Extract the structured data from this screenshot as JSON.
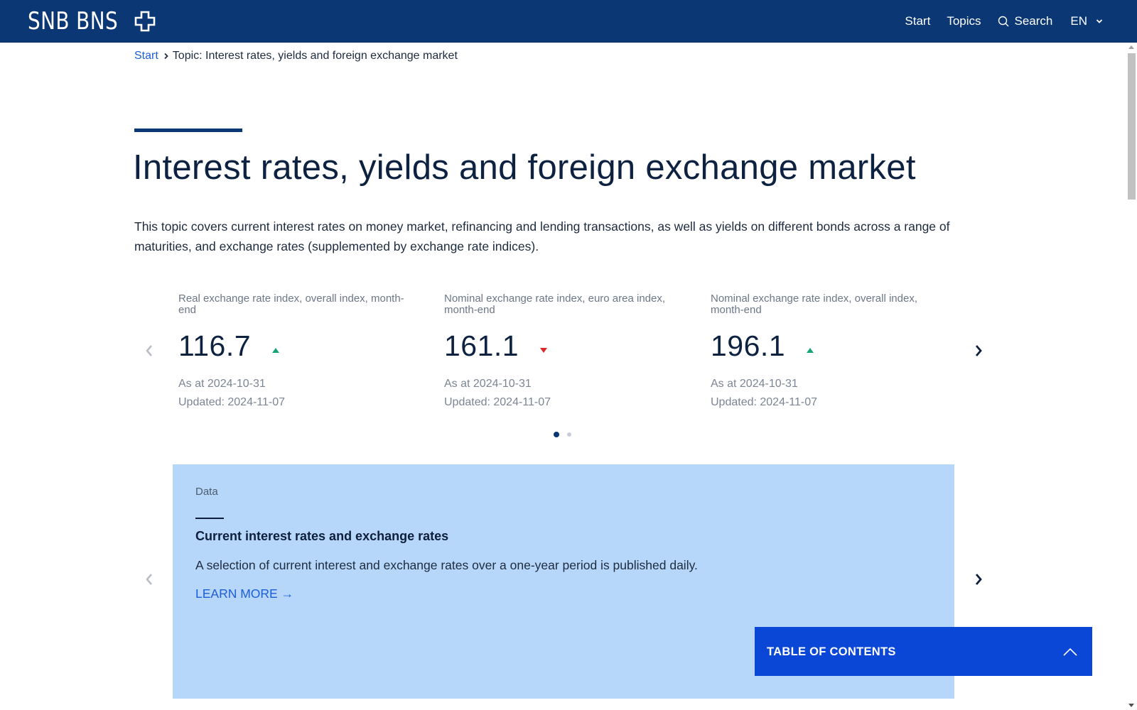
{
  "header": {
    "logo_text": "SNB BNS",
    "nav": {
      "start": "Start",
      "topics": "Topics",
      "search": "Search",
      "language": "EN"
    }
  },
  "breadcrumb": {
    "start": "Start",
    "current": "Topic: Interest rates, yields and foreign exchange market"
  },
  "page": {
    "title": "Interest rates, yields and foreign exchange market",
    "intro": "This topic covers current interest rates on money market, refinancing and lending transactions, as well as yields on different bonds across a range of maturities, and exchange rates (supplemented by exchange rate indices)."
  },
  "indicators": [
    {
      "label": "Real exchange rate index, overall index, month-end",
      "value": "116.7",
      "trend": "up",
      "as_at": "As at 2024-10-31",
      "updated": "Updated: 2024-11-07"
    },
    {
      "label": "Nominal exchange rate index, euro area index, month-end",
      "value": "161.1",
      "trend": "down",
      "as_at": "As at 2024-10-31",
      "updated": "Updated: 2024-11-07"
    },
    {
      "label": "Nominal exchange rate index, overall index, month-end",
      "value": "196.1",
      "trend": "up",
      "as_at": "As at 2024-10-31",
      "updated": "Updated: 2024-11-07"
    }
  ],
  "carousel": {
    "pages": 2,
    "active_page": 1
  },
  "card": {
    "kicker": "Data",
    "title": "Current interest rates and exchange rates",
    "text": "A selection of current interest and exchange rates over a one-year period is published daily.",
    "link": "LEARN MORE →"
  },
  "toc": {
    "label": "TABLE OF CONTENTS"
  },
  "colors": {
    "header_bg": "#0b3774",
    "link": "#1c5ed6",
    "trend_up": "#17a673",
    "trend_down": "#d92b2b",
    "card_bg": "#b7d7fa",
    "toc_bg": "#0b47d6"
  },
  "icons": {
    "logo_cross": "swiss-cross-icon",
    "search": "search-icon",
    "language_chevron": "chevron-down-icon",
    "carousel_prev": "chevron-left-icon",
    "carousel_next": "chevron-right-icon",
    "toc_caret": "chevron-up-icon"
  }
}
